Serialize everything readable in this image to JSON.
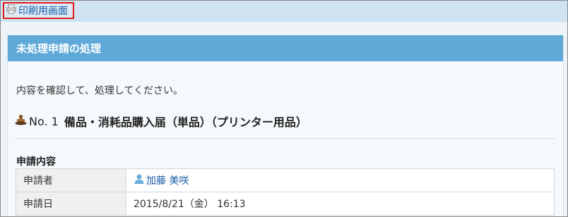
{
  "toolbar": {
    "print_label": "印刷用画面",
    "print_icon": "printer-icon"
  },
  "panel": {
    "title": "未処理申請の処理",
    "instruction": "内容を確認して、処理してください。",
    "request": {
      "icon": "stamp-icon",
      "number": "No. 1",
      "name": "備品・消耗品購入届（単品）（プリンター用品）"
    },
    "section_label": "申請内容",
    "rows": [
      {
        "label": "申請者",
        "value": "加藤 美咲",
        "icon": "user-icon"
      },
      {
        "label": "申請日",
        "value": "2015/8/21（金） 16:13"
      }
    ]
  },
  "colors": {
    "header_bg": "#5ea9d8",
    "topbar_bg": "#cfe3f3",
    "link": "#1a5da8",
    "highlight_border": "#e01b1b"
  }
}
